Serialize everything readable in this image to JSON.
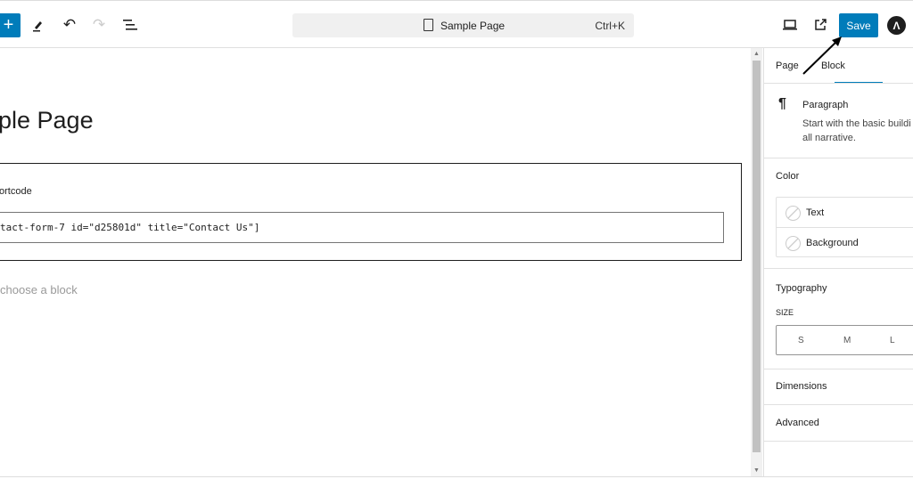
{
  "header": {
    "document_title": "Sample Page",
    "shortcut": "Ctrl+K",
    "save_label": "Save",
    "icons": [
      "plus-icon",
      "pencil-icon",
      "undo-icon",
      "redo-icon",
      "list-view-icon",
      "document-icon",
      "desktop-preview-icon",
      "external-link-icon",
      "astra-logo-icon"
    ]
  },
  "canvas": {
    "title": "ple Page",
    "shortcode_label": "ortcode",
    "shortcode_value": "tact-form-7 id=\"d25801d\" title=\"Contact Us\"]",
    "block_hint": "choose a block"
  },
  "sidebar": {
    "tabs": [
      {
        "label": "Page"
      },
      {
        "label": "Block",
        "active": true
      }
    ],
    "block": {
      "name": "Paragraph",
      "desc1": "Start with the basic buildi",
      "desc2": "all narrative."
    },
    "color": {
      "title": "Color",
      "items": [
        "Text",
        "Background"
      ]
    },
    "typography": {
      "title": "Typography",
      "size_label": "SIZE",
      "sizes": [
        "S",
        "M",
        "L"
      ]
    },
    "dimensions": "Dimensions",
    "advanced": "Advanced"
  },
  "colors": {
    "accent": "#007cba"
  }
}
